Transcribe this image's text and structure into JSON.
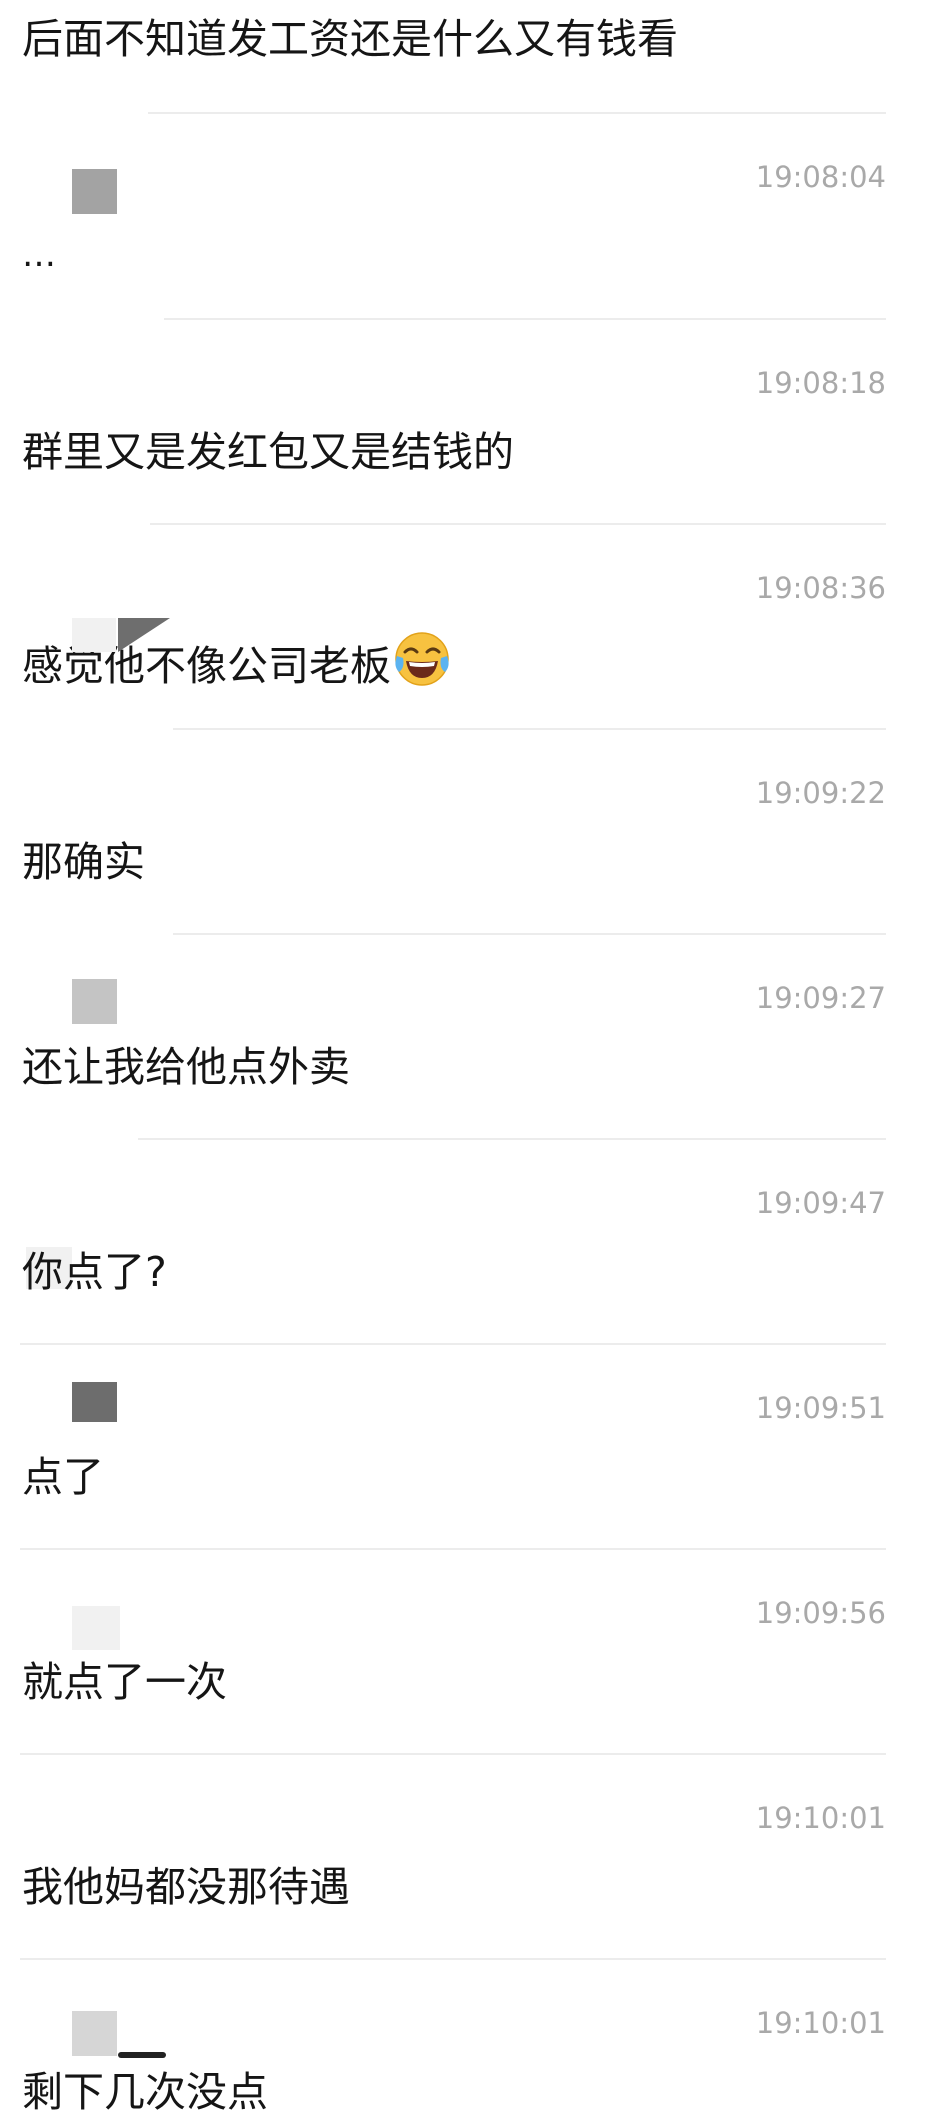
{
  "header_message": "后面不知道发工资还是什么又有钱看",
  "messages": [
    {
      "time": "19:08:04",
      "text": "…",
      "avatar_color": "#a3a3a3"
    },
    {
      "time": "19:08:18",
      "text": "群里又是发红包又是结钱的"
    },
    {
      "time": "19:08:36",
      "text": "感觉他不像公司老板",
      "emoji": "face-with-tears-of-joy"
    },
    {
      "time": "19:09:22",
      "text": "那确实"
    },
    {
      "time": "19:09:27",
      "text": "还让我给他点外卖",
      "avatar_color": "#c4c4c4"
    },
    {
      "time": "19:09:47",
      "text": "你点了?"
    },
    {
      "time": "19:09:51",
      "text": "点了",
      "avatar_color": "#6d6d6d"
    },
    {
      "time": "19:09:56",
      "text": "就点了一次"
    },
    {
      "time": "19:10:01",
      "text": "我他妈都没那待遇"
    },
    {
      "time": "19:10:01",
      "text": "剩下几次没点",
      "avatar_color": "#d6d6d6"
    }
  ],
  "colors": {
    "background": "#ffffff",
    "text": "#151515",
    "timestamp": "#a9a9a9",
    "divider": "#ececec"
  }
}
